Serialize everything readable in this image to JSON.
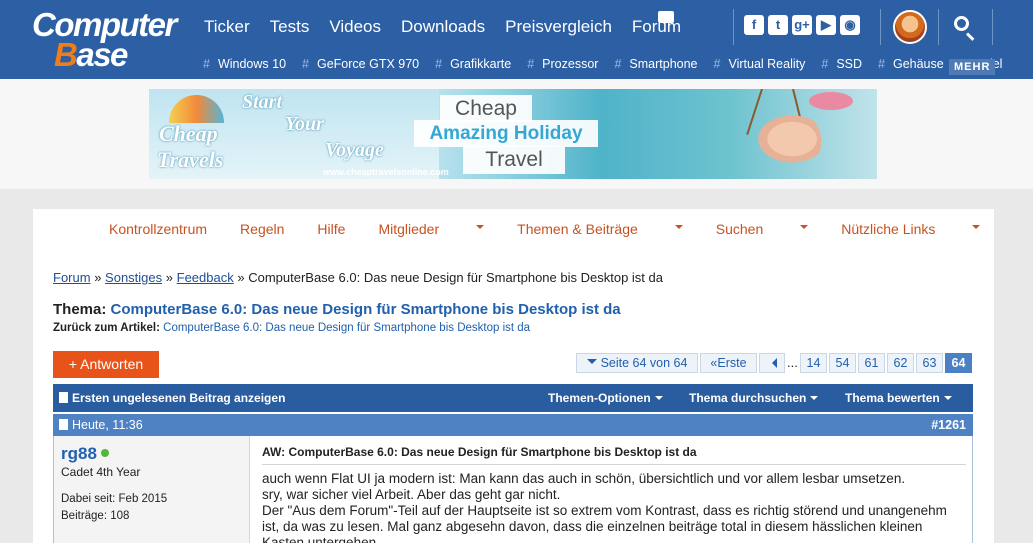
{
  "header": {
    "logo_line1": "Computer",
    "logo_line2_prefix": "B",
    "logo_line2_rest": "ase",
    "nav": [
      "Ticker",
      "Tests",
      "Videos",
      "Downloads",
      "Preisvergleich",
      "Forum"
    ],
    "social_icons": [
      "facebook-icon",
      "twitter-icon",
      "googleplus-icon",
      "youtube-icon",
      "rss-icon"
    ],
    "tags": [
      "Windows 10",
      "GeForce GTX 970",
      "Grafikkarte",
      "Prozessor",
      "Smartphone",
      "Virtual Reality",
      "SSD",
      "Gehäuse",
      "Spiel"
    ],
    "more_label": "MEHR"
  },
  "ad": {
    "brand_line1": "Cheap",
    "brand_line2": "Travels",
    "tagline1": "Start",
    "tagline2": "Your",
    "tagline3": "Voyage",
    "url": "www.cheaptravelsonline.com",
    "box1": "Cheap",
    "box2": "Amazing Holiday",
    "box3": "Travel"
  },
  "forum_nav": [
    "Kontrollzentrum",
    "Regeln",
    "Hilfe",
    "Mitglieder",
    "Themen & Beiträge",
    "Suchen",
    "Nützliche Links"
  ],
  "breadcrumb": {
    "items": [
      "Forum",
      "Sonstiges",
      "Feedback"
    ],
    "sep": "»",
    "current": "ComputerBase 6.0: Das neue Design für Smartphone bis Desktop ist da"
  },
  "thread": {
    "label": "Thema:",
    "title": "ComputerBase 6.0: Das neue Design für Smartphone bis Desktop ist da",
    "back_label": "Zurück zum Artikel:",
    "back_link": "ComputerBase 6.0: Das neue Design für Smartphone bis Desktop ist da"
  },
  "reply_button": "Antworten",
  "pagination": {
    "page_info": "Seite 64 von 64",
    "first": "Erste",
    "ellipsis": "...",
    "pages": [
      "14",
      "54",
      "61",
      "62",
      "63"
    ],
    "current": "64"
  },
  "toolbar": {
    "first_unread": "Ersten ungelesenen Beitrag anzeigen",
    "options": "Themen-Optionen",
    "search": "Thema durchsuchen",
    "rate": "Thema bewerten"
  },
  "post": {
    "date": "Heute, 11:36",
    "number": "#1261",
    "username": "rg88",
    "rank": "Cadet 4th Year",
    "member_since": "Dabei seit: Feb 2015",
    "posts": "Beiträge: 108",
    "title": "AW: ComputerBase 6.0: Das neue Design für Smartphone bis Desktop ist da",
    "lines": [
      "auch wenn Flat UI ja modern ist: Man kann das auch in schön, übersichtlich und vor allem lesbar umsetzen.",
      "sry, war sicher viel Arbeit. Aber das geht gar nicht.",
      "Der \"Aus dem Forum\"-Teil auf der Hauptseite ist so extrem vom Kontrast, dass es richtig störend und unangenehm ist, da was zu lesen. Mal ganz abgesehn davon, dass die einzelnen beiträge total in diesem hässlichen kleinen Kasten untergehen."
    ]
  },
  "colors": {
    "header_blue": "#2c5fa3",
    "accent_orange": "#e8531a",
    "link_blue": "#2160ad"
  }
}
